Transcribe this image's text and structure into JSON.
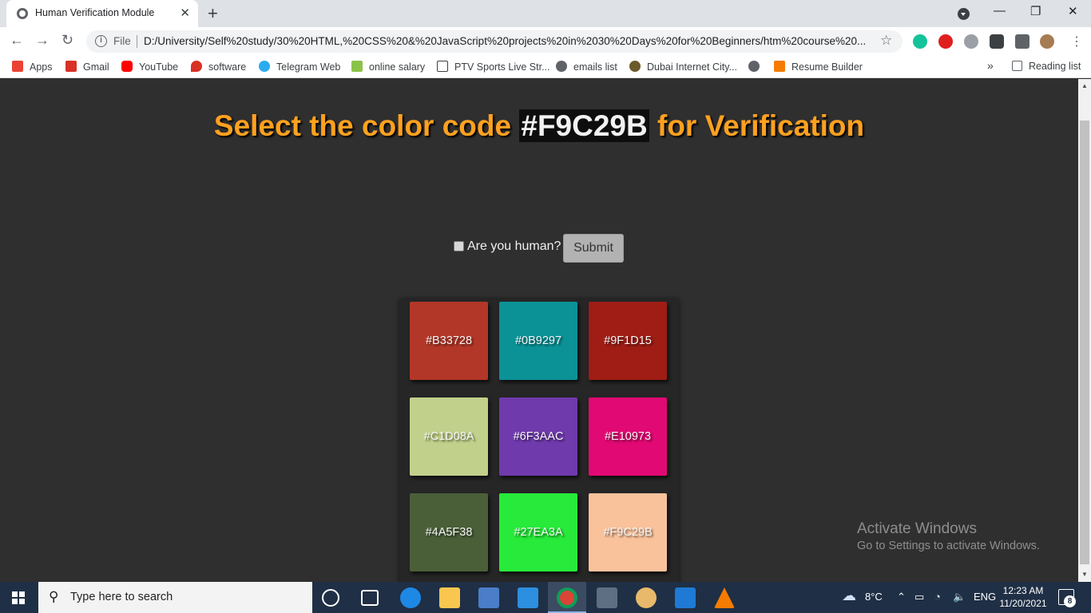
{
  "browser": {
    "tab_title": "Human Verification Module",
    "tab_close": "✕",
    "new_tab": "+",
    "window_controls": {
      "minimize": "—",
      "restore": "❐",
      "close": "✕"
    },
    "scheme": "File",
    "url": "D:/University/Self%20study/30%20HTML,%20CSS%20&%20JavaScript%20projects%20in%2030%20Days%20for%20Beginners/htm%20course%20..."
  },
  "bookmarks": [
    {
      "label": "Apps",
      "color": "#ea4335"
    },
    {
      "label": "Gmail",
      "color": "#d93025"
    },
    {
      "label": "YouTube",
      "color": "#ff0000"
    },
    {
      "label": "software",
      "color": "#d93025"
    },
    {
      "label": "Telegram Web",
      "color": "#2aabee"
    },
    {
      "label": "online salary",
      "color": "#8bc34a"
    },
    {
      "label": "PTV Sports Live Str...",
      "color": "#3c4043"
    },
    {
      "label": "emails list",
      "color": "#5f6368"
    },
    {
      "label": "Dubai Internet City...",
      "color": "#6b5b2a"
    },
    {
      "label": "",
      "color": "#5f6368"
    },
    {
      "label": "Resume Builder",
      "color": "#f57c00"
    }
  ],
  "bookmarks_overflow": "»",
  "reading_list": "Reading list",
  "page": {
    "heading_prefix": "Select the color code ",
    "target_code": "#F9C29B",
    "heading_suffix": " for Verification",
    "checkbox_label": "Are you human?",
    "submit_label": "Submit",
    "swatches": [
      {
        "code": "#B33728",
        "color": "#B33728"
      },
      {
        "code": "#0B9297",
        "color": "#0B9297"
      },
      {
        "code": "#9F1D15",
        "color": "#9F1D15"
      },
      {
        "code": "#C1D08A",
        "color": "#C1D08A"
      },
      {
        "code": "#6F3AAC",
        "color": "#6F3AAC"
      },
      {
        "code": "#E10973",
        "color": "#E10973"
      },
      {
        "code": "#4A5F38",
        "color": "#4A5F38"
      },
      {
        "code": "#27EA3A",
        "color": "#27EA3A"
      },
      {
        "code": "#F9C29B",
        "color": "#F9C29B"
      }
    ]
  },
  "watermark": {
    "title": "Activate Windows",
    "subtitle": "Go to Settings to activate Windows."
  },
  "taskbar": {
    "search_placeholder": "Type here to search",
    "temperature": "8°C",
    "language": "ENG",
    "time": "12:23 AM",
    "date": "11/20/2021",
    "notification_count": "8"
  }
}
